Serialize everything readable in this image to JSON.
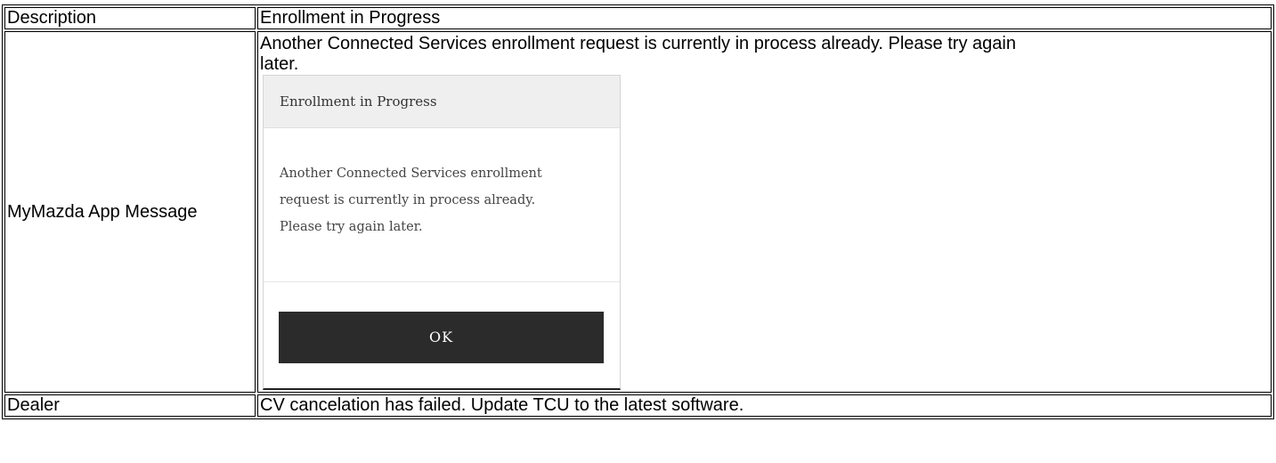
{
  "rows": {
    "description": {
      "label": "Description",
      "value": "Enrollment in Progress"
    },
    "app_message": {
      "label": "MyMazda App Message",
      "text": "Another Connected Services enrollment request is currently in process already. Please try again later."
    },
    "dealer": {
      "label": "Dealer",
      "value": "CV cancelation has failed. Update TCU to the latest software."
    }
  },
  "dialog": {
    "title": "Enrollment in Progress",
    "body_lines": [
      "Another Connected Services enrollment",
      "request is currently in process already.",
      "Please try again later."
    ],
    "ok_label": "OK"
  },
  "colors": {
    "dialog_header_bg": "#efefef",
    "ok_button_bg": "#2b2b2b",
    "heading_accent": "#1f6fb2"
  }
}
